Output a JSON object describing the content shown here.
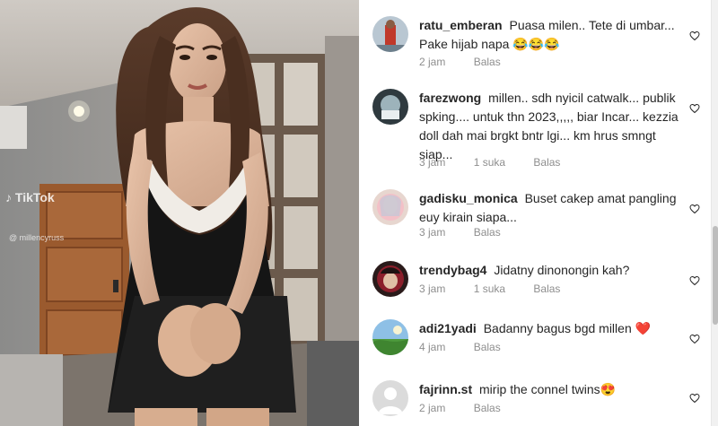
{
  "post": {
    "watermark_brand": "TikTok",
    "watermark_handle": "@ millencyruss"
  },
  "comments": [
    {
      "username": "ratu_emberan",
      "text": "Puasa milen.. Tete di umbar... Pake hijab napa 😂😂😂",
      "time": "2 jam",
      "likes": "",
      "reply": "Balas"
    },
    {
      "username": "farezwong",
      "text": "millen.. sdh nyicil catwalk... publik spking.... untuk thn 2023,,,,, biar Incar... kezzia doll dah mai brgkt bntr lgi... km hrus smngt siap...",
      "time": "3 jam",
      "likes": "1 suka",
      "reply": "Balas"
    },
    {
      "username": "gadisku_monica",
      "text": "Buset cakep amat pangling euy kirain siapa...",
      "time": "3 jam",
      "likes": "",
      "reply": "Balas"
    },
    {
      "username": "trendybag4",
      "text": "Jidatny dinonongin kah?",
      "time": "3 jam",
      "likes": "1 suka",
      "reply": "Balas"
    },
    {
      "username": "adi21yadi",
      "text": "Badanny bagus bgd millen ❤️",
      "time": "4 jam",
      "likes": "",
      "reply": "Balas"
    },
    {
      "username": "fajrinn.st",
      "text": "mirip the connel twins😍",
      "time": "2 jam",
      "likes": "",
      "reply": "Balas"
    }
  ],
  "icons": {
    "like": "heart-outline-icon",
    "default_avatar": "person-silhouette-icon"
  },
  "colors": {
    "text": "#262626",
    "secondary": "#8e8e8e",
    "background": "#ffffff"
  }
}
